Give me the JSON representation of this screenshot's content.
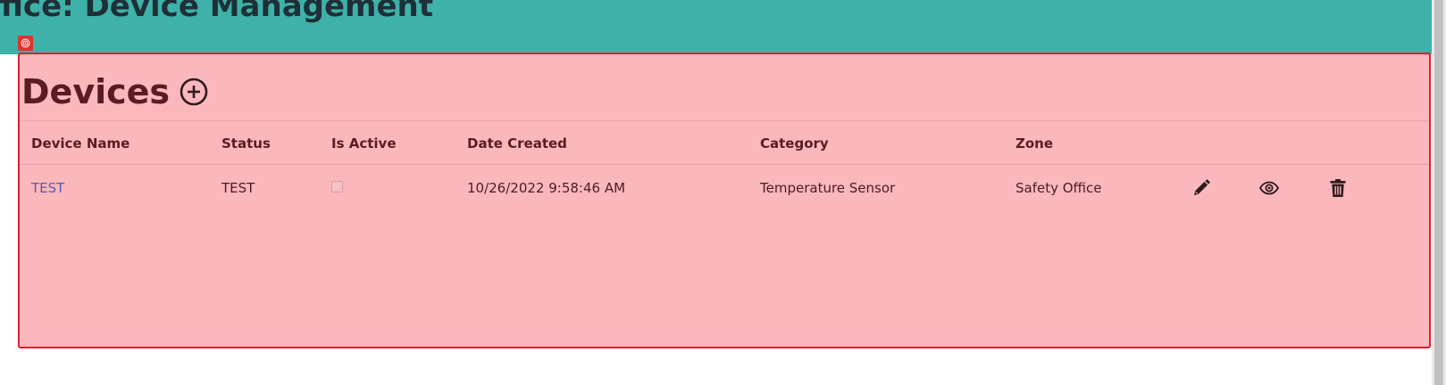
{
  "header": {
    "title": "ffice: Device Management"
  },
  "devices_panel": {
    "title": "Devices",
    "add_icon": "plus-circle-icon",
    "columns": [
      "Device Name",
      "Status",
      "Is Active",
      "Date Created",
      "Category",
      "Zone"
    ],
    "rows": [
      {
        "device_name": "TEST",
        "status": "TEST",
        "is_active": false,
        "date_created": "10/26/2022 9:58:46 AM",
        "category": "Temperature Sensor",
        "zone": "Safety Office",
        "actions": [
          "pencil-icon",
          "eye-icon",
          "trash-icon"
        ]
      }
    ]
  },
  "colors": {
    "header_band": "#3eb1a8",
    "panel_background": "#fbb8bc",
    "panel_border": "#e01e2c",
    "text_dark": "#5a1b22",
    "link": "#5b5aa9"
  }
}
